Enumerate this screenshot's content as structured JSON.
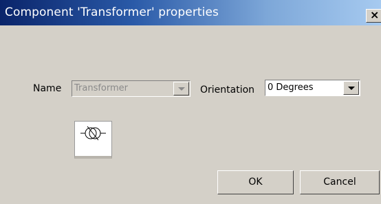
{
  "window": {
    "title": "Component 'Transformer' properties",
    "close_icon": "close-icon"
  },
  "form": {
    "name_label": "Name",
    "name_value": "Transformer",
    "name_enabled": false,
    "orientation_label": "Orientation",
    "orientation_value": "0 Degrees"
  },
  "preview": {
    "icon": "transformer-symbol-icon"
  },
  "buttons": {
    "ok_label": "OK",
    "cancel_label": "Cancel"
  }
}
